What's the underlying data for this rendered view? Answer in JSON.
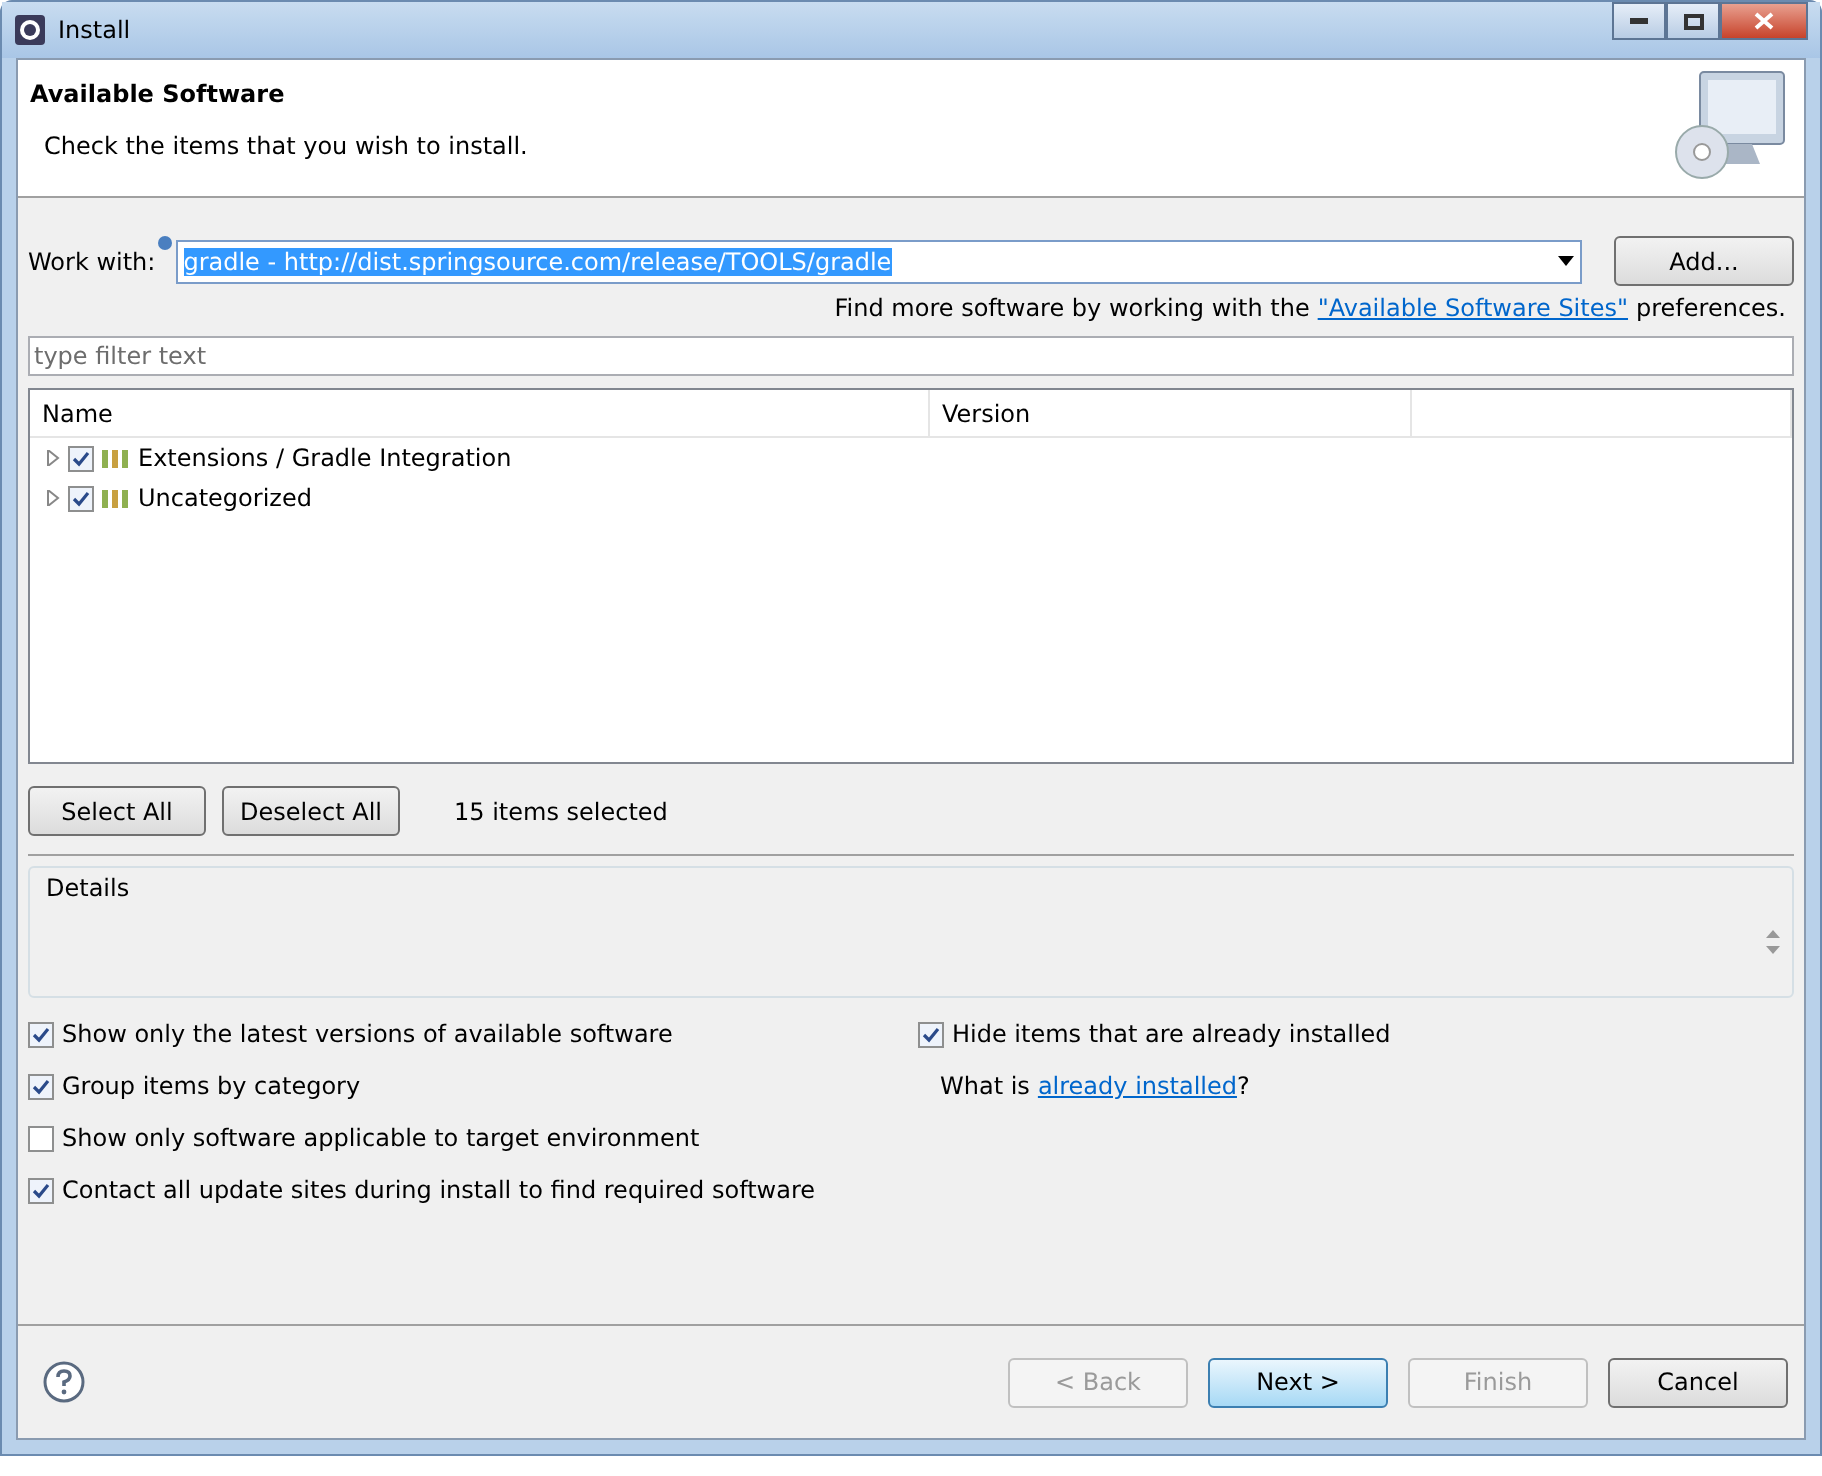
{
  "window": {
    "title": "Install"
  },
  "header": {
    "title": "Available Software",
    "subtitle": "Check the items that you wish to install."
  },
  "work_with": {
    "label": "Work with:",
    "value": "gradle - http://dist.springsource.com/release/TOOLS/gradle",
    "button": "Add..."
  },
  "sites_hint": {
    "before": "Find more software by working with the",
    "link": "\"Available Software Sites\"",
    "after": "preferences."
  },
  "filter": {
    "placeholder": "type filter text"
  },
  "tree": {
    "columns": [
      "Name",
      "Version"
    ],
    "rows": [
      {
        "label": "Extensions / Gradle Integration",
        "checked": true,
        "expanded": false
      },
      {
        "label": "Uncategorized",
        "checked": true,
        "expanded": false
      }
    ]
  },
  "selection": {
    "buttons": [
      "Select All",
      "Deselect All"
    ],
    "count": "15 items selected"
  },
  "details": {
    "title": "Details"
  },
  "options": [
    {
      "label": "Show only the latest versions of available software",
      "checked": true
    },
    {
      "label": "Group items by category",
      "checked": true
    },
    {
      "label": "Show only software applicable to target environment",
      "checked": false
    },
    {
      "label": "Contact all update sites during install to find required software",
      "checked": true
    }
  ],
  "hide_installed": {
    "label": "Hide items that are already installed",
    "checked": true
  },
  "what_is": {
    "before": "What is",
    "link": "already installed",
    "after": "?"
  },
  "footer": {
    "buttons": [
      {
        "label": "< Back",
        "disabled": true,
        "default": false
      },
      {
        "label": "Next >",
        "disabled": false,
        "default": true
      },
      {
        "label": "Finish",
        "disabled": true,
        "default": false
      },
      {
        "label": "Cancel",
        "disabled": false,
        "default": false
      }
    ]
  }
}
